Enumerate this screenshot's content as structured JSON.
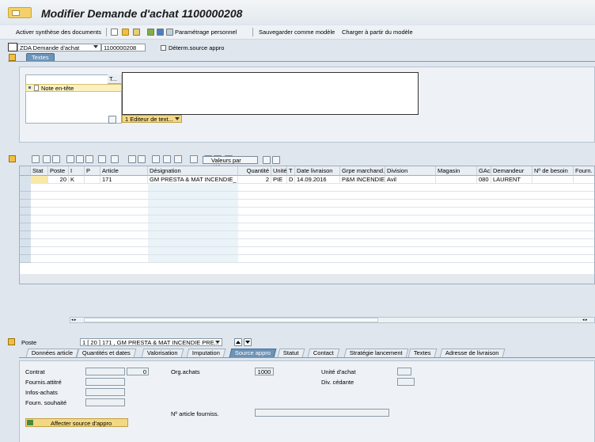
{
  "window": {
    "title": "Modifier Demande d'achat 1100000208"
  },
  "toolbar": {
    "activer": "Activer synthèse des documents",
    "param": "Paramétrage personnel",
    "save_model": "Sauvegarder comme modèle",
    "load_model": "Charger à partir du modèle"
  },
  "header": {
    "doc_type": "ZDA Demande d'achat",
    "doc_number": "1100000208",
    "determ": "Déterm.source appro",
    "tab_textes": "Textes"
  },
  "texts": {
    "col_t": "T...",
    "node": "Note en-tête",
    "editor": "1 Editeur de text..."
  },
  "item_toolbar": {
    "valeurs": "Valeurs par défaut"
  },
  "grid": {
    "columns": [
      "Stat",
      "Poste",
      "I",
      "P",
      "Article",
      "Désignation",
      "Quantité",
      "Unité",
      "T",
      "Date livraison",
      "Grpe marchand.",
      "Division",
      "Magasin",
      "GAc",
      "Demandeur",
      "Nº de besoin",
      "Fourn. so"
    ],
    "row": {
      "poste": "20",
      "i": "K",
      "article": "171",
      "designation": "GM PRESTA & MAT INCENDIE_",
      "quantite": "2",
      "unite": "PIE",
      "t": "D",
      "date": "14.09.2016",
      "grpe": "P&M INCENDIE",
      "division": "Avil",
      "gac": "080",
      "demandeur": "LAURENT"
    }
  },
  "poste": {
    "label": "Poste",
    "value": "1 [ 20 ] 171 , GM PRESTA & MAT INCENDIE PRE..."
  },
  "tabs": [
    "Données article",
    "Quantités et dates",
    "Valorisation",
    "Imputation",
    "Source appro",
    "Statut",
    "Contact",
    "Stratégie lancement",
    "Textes",
    "Adresse de livraison"
  ],
  "source": {
    "contrat_label": "Contrat",
    "contrat_pos": "0",
    "fournis_label": "Fournis.attitré",
    "infos_label": "Infos-achats",
    "fourn_souh_label": "Fourn. souhaité",
    "org_label": "Org.achats",
    "org_value": "1000",
    "unite_label": "Unité d'achat",
    "div_label": "Div. cédante",
    "article_fourn_label": "Nº article fourniss.",
    "affecter": "Affecter source d'appro"
  }
}
